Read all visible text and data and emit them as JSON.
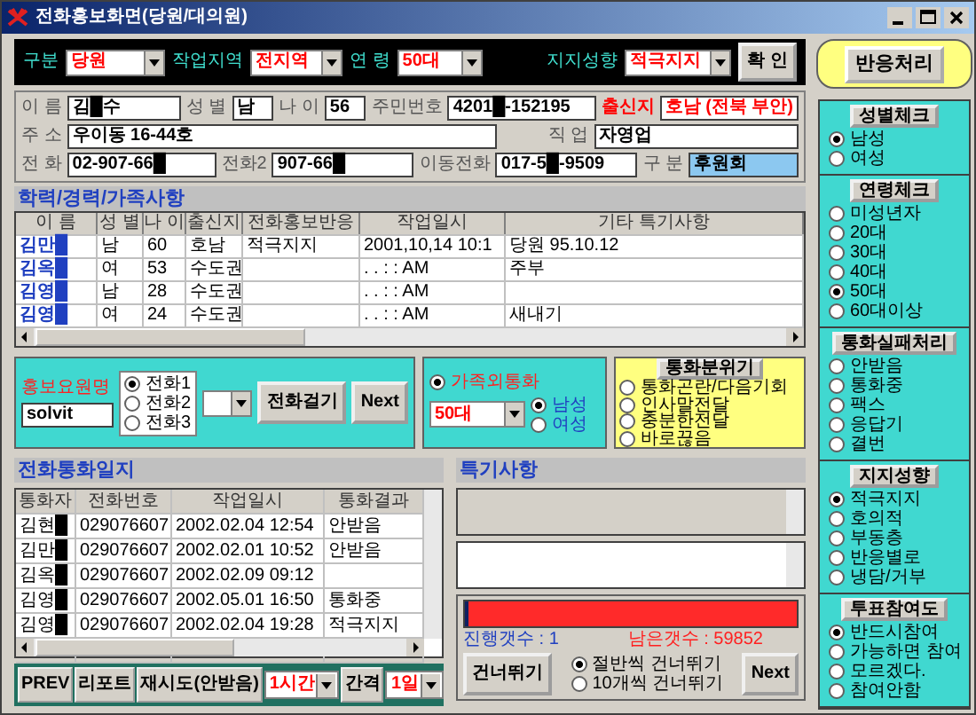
{
  "window": {
    "title": "전화홍보화면(당원/대의원)"
  },
  "filter_bar": {
    "fields": [
      {
        "label": "구분",
        "value": "당원"
      },
      {
        "label": "작업지역",
        "value": "전지역"
      },
      {
        "label": "연 령",
        "value": "50대"
      },
      {
        "label": "지지성향",
        "value": "적극지지"
      }
    ],
    "confirm_button": "확 인"
  },
  "reaction_button": "반응처리",
  "person": {
    "lines": [
      {
        "fields": [
          {
            "label": "이 름",
            "value": "김█수",
            "highlighted": false,
            "emphasis": false
          },
          {
            "label": "성 별",
            "value": "남",
            "highlighted": false,
            "emphasis": false
          },
          {
            "label": "나 이",
            "value": "56",
            "highlighted": false,
            "emphasis": false
          },
          {
            "label": "주민번호",
            "value": "4201█-152195",
            "highlighted": false,
            "emphasis": false
          },
          {
            "label": "출신지",
            "value": "호남 (전북 부안)",
            "highlighted": false,
            "emphasis": true
          }
        ]
      },
      {
        "fields": [
          {
            "label": "주 소",
            "value": "우이동 16-44호",
            "highlighted": false,
            "emphasis": false
          },
          {
            "label": "직 업",
            "value": "자영업",
            "highlighted": false,
            "emphasis": false
          }
        ]
      },
      {
        "fields": [
          {
            "label": "전 화",
            "value": "02-907-66█",
            "highlighted": false,
            "emphasis": false
          },
          {
            "label": "전화2",
            "value": "907-66█",
            "highlighted": false,
            "emphasis": false
          },
          {
            "label": "이동전화",
            "value": "017-5█-9509",
            "highlighted": false,
            "emphasis": false
          },
          {
            "label": "구 분",
            "value": "후원회",
            "highlighted": true,
            "emphasis": false
          }
        ]
      }
    ]
  },
  "family": {
    "title": "학력/경력/가족사항",
    "columns": [
      "이 름",
      "성 별",
      "나 이",
      "출신지",
      "전화홍보반응",
      "작업일시",
      "기타 특기사항"
    ],
    "rows": [
      [
        "김만█",
        "남",
        "60",
        "호남",
        "적극지지",
        "2001,10,14 10:1",
        "당원 95.10.12"
      ],
      [
        "김옥█",
        "여",
        "53",
        "수도권",
        "",
        ". .   : :  AM",
        "주부"
      ],
      [
        "김영█",
        "남",
        "28",
        "수도권",
        "",
        ". .   : :  AM",
        ""
      ],
      [
        "김영█",
        "여",
        "24",
        "수도권",
        "",
        ". .   : :  AM",
        "새내기"
      ]
    ]
  },
  "caller": {
    "label": "홍보요원명",
    "value": "solvit",
    "phone_options": [
      {
        "label": "전화1",
        "selected": true
      },
      {
        "label": "전화2",
        "selected": false
      },
      {
        "label": "전화3",
        "selected": false
      }
    ],
    "buttons": [
      "전화걸기",
      "Next"
    ]
  },
  "family_call": {
    "label": "가족외통화",
    "selected": true,
    "age": "50대",
    "genders": [
      {
        "label": "남성",
        "selected": true
      },
      {
        "label": "여성",
        "selected": false
      }
    ]
  },
  "mood": {
    "title": "통화분위기",
    "options": [
      {
        "label": "통화곤란/다음기회",
        "selected": false
      },
      {
        "label": "인사말전달",
        "selected": false
      },
      {
        "label": "충분한전달",
        "selected": false
      },
      {
        "label": "바로끊음",
        "selected": false
      }
    ]
  },
  "call_log": {
    "title": "전화통화일지",
    "columns": [
      "통화자",
      "전화번호",
      "작업일시",
      "통화결과"
    ],
    "rows": [
      [
        "김현█",
        "029076607",
        "2002.02.04 12:54",
        "안받음"
      ],
      [
        "김만█",
        "029076607",
        "2002.02.01 10:52",
        "안받음"
      ],
      [
        "김옥█",
        "029076607",
        "2002.02.09  09:12",
        ""
      ],
      [
        "김영█",
        "029076607",
        "2002.05.01 16:50",
        "통화중"
      ],
      [
        "김영█",
        "029076607",
        "2002.02.04 19:28",
        "적극지지"
      ]
    ]
  },
  "bottom_bar": {
    "buttons": [
      "PREV",
      "리포트",
      "재시도(안받음)"
    ],
    "period": "1시간",
    "interval_button": "간격",
    "interval": "1일"
  },
  "notes": {
    "title": "특기사항"
  },
  "progress": {
    "level": 1,
    "done": "진행갯수 : 1",
    "remaining": "남은갯수 : 59852",
    "skip_button": "건너뛰기",
    "skip_options": [
      {
        "label": "절반씩 건너뛰기",
        "selected": true
      },
      {
        "label": "10개씩 건너뛰기",
        "selected": false
      }
    ],
    "next_button": "Next"
  },
  "check_groups": [
    {
      "title": "성별체크",
      "options": [
        {
          "label": "남성",
          "selected": true
        },
        {
          "label": "여성",
          "selected": false
        }
      ]
    },
    {
      "title": "연령체크",
      "options": [
        {
          "label": "미성년자",
          "selected": false
        },
        {
          "label": "20대",
          "selected": false
        },
        {
          "label": "30대",
          "selected": false
        },
        {
          "label": "40대",
          "selected": false
        },
        {
          "label": "50대",
          "selected": true
        },
        {
          "label": "60대이상",
          "selected": false
        }
      ]
    },
    {
      "title": "통화실패처리",
      "options": [
        {
          "label": "안받음",
          "selected": false
        },
        {
          "label": "통화중",
          "selected": false
        },
        {
          "label": "팩스",
          "selected": false
        },
        {
          "label": "응답기",
          "selected": false
        },
        {
          "label": "결번",
          "selected": false
        }
      ]
    },
    {
      "title": "지지성향",
      "options": [
        {
          "label": "적극지지",
          "selected": true
        },
        {
          "label": "호의적",
          "selected": false
        },
        {
          "label": "부동층",
          "selected": false
        },
        {
          "label": "반응별로",
          "selected": false
        },
        {
          "label": "냉담/거부",
          "selected": false
        }
      ]
    },
    {
      "title": "투표참여도",
      "options": [
        {
          "label": "반드시참여",
          "selected": true
        },
        {
          "label": "가능하면 참여",
          "selected": false
        },
        {
          "label": "모르겠다.",
          "selected": false
        },
        {
          "label": "참여안함",
          "selected": false
        }
      ]
    }
  ]
}
